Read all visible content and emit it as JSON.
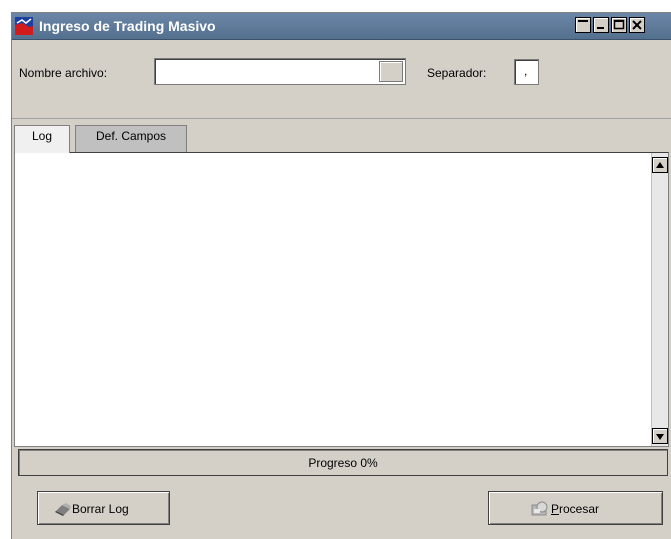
{
  "window": {
    "title": "Ingreso de Trading Masivo",
    "buttons": {
      "minimize": "minimize-icon",
      "restore": "restore-icon",
      "maximize": "maximize-icon",
      "close": "close-icon"
    }
  },
  "form": {
    "file_label": "Nombre archivo:",
    "file_value": "",
    "separator_label": "Separador:",
    "separator_value": ","
  },
  "tabs": [
    {
      "label": "Log",
      "active": true
    },
    {
      "label": "Def. Campos",
      "active": false
    }
  ],
  "log": {
    "content": ""
  },
  "progress": {
    "label": "Progreso 0%",
    "value": 0
  },
  "actions": {
    "clear_log": {
      "label": "Borrar Log",
      "icon": "eraser-icon"
    },
    "process": {
      "mnemonic": "P",
      "label_rest": "rocesar",
      "icon": "process-icon"
    }
  },
  "colors": {
    "title_bar": "#6b86a6",
    "window_bg": "#d4d0c8"
  }
}
